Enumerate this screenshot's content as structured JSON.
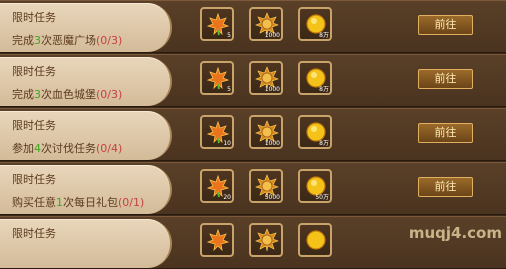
{
  "tasks": [
    {
      "title": "限时任务",
      "desc_pre": "完成",
      "highlight": "3",
      "desc_post": "次恶魔广场",
      "progress": "(0/3)",
      "rewards": [
        {
          "icon": "maple-leaf-icon",
          "qty": "5"
        },
        {
          "icon": "gold-badge-icon",
          "qty": "1000"
        },
        {
          "icon": "gold-coin-icon",
          "qty": "8万"
        }
      ],
      "button": "前往"
    },
    {
      "title": "限时任务",
      "desc_pre": "完成",
      "highlight": "3",
      "desc_post": "次血色城堡",
      "progress": "(0/3)",
      "rewards": [
        {
          "icon": "maple-leaf-icon",
          "qty": "5"
        },
        {
          "icon": "gold-badge-icon",
          "qty": "1000"
        },
        {
          "icon": "gold-coin-icon",
          "qty": "8万"
        }
      ],
      "button": "前往"
    },
    {
      "title": "限时任务",
      "desc_pre": "参加",
      "highlight": "4",
      "desc_post": "次讨伐任务",
      "progress": "(0/4)",
      "rewards": [
        {
          "icon": "maple-leaf-icon",
          "qty": "10"
        },
        {
          "icon": "gold-badge-icon",
          "qty": "1000"
        },
        {
          "icon": "gold-coin-icon",
          "qty": "8万"
        }
      ],
      "button": "前往"
    },
    {
      "title": "限时任务",
      "desc_pre": "购买任意",
      "highlight": "1",
      "desc_post": "次每日礼包",
      "progress": "(0/1)",
      "rewards": [
        {
          "icon": "maple-leaf-icon",
          "qty": "20"
        },
        {
          "icon": "gold-badge-icon",
          "qty": "5000"
        },
        {
          "icon": "gold-coin-icon",
          "qty": "50万"
        }
      ],
      "button": "前往"
    },
    {
      "title": "限时任务",
      "desc_pre": "",
      "highlight": "",
      "desc_post": "",
      "progress": "",
      "rewards": [
        {
          "icon": "maple-leaf-icon",
          "qty": ""
        },
        {
          "icon": "gold-badge-icon",
          "qty": ""
        },
        {
          "icon": "gold-coin-icon",
          "qty": ""
        }
      ],
      "button": ""
    }
  ],
  "watermark": "muqj4.com"
}
